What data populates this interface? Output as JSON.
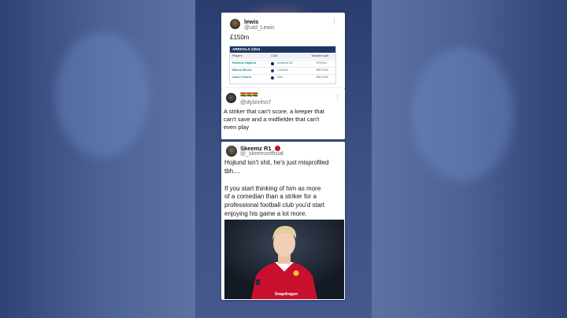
{
  "tweet1": {
    "name": "lewis",
    "handle": "@utd_Lewis",
    "text": "£150m",
    "table": {
      "title": "ARRIVALS 23/24",
      "columns": [
        "Players",
        "Club",
        "Transfer sum"
      ],
      "rows": [
        {
          "player": "Rasmus Højlund",
          "club": "Atalanta BC",
          "fee": "€73.9m"
        },
        {
          "player": "Mason Mount",
          "club": "Chelsea",
          "fee": "€64.20m"
        },
        {
          "player": "André Onana",
          "club": "Inter",
          "fee": "€50.20m"
        }
      ]
    }
  },
  "tweet2": {
    "name": "🇬🇭🇬🇭🇬🇭",
    "handle": "@dylzinho7",
    "lines": [
      "A striker that can't score, a keeper that",
      "can't save and a midfielder that can't",
      "even play"
    ]
  },
  "tweet3": {
    "name": "Skeemz R1",
    "handle": "@_skeemzofficial",
    "lines1": [
      "Hojlund isn't shit, he's just misprofiled",
      "tbh...."
    ],
    "lines2": [
      "If you start thinking of him as more",
      "of a comedian than a striker for a",
      "professional football club you'd start",
      "enjoying his game a lot more."
    ],
    "photo_sponsor": "Snapdragon"
  },
  "icons": {
    "more": "more-options-icon",
    "verified": "red-badge-icon",
    "sponsor_logo": "snapdragon-logo"
  },
  "colors": {
    "table_header": "#1d3763",
    "table_text": "#1f8b86",
    "shirt_red": "#c8102e"
  }
}
